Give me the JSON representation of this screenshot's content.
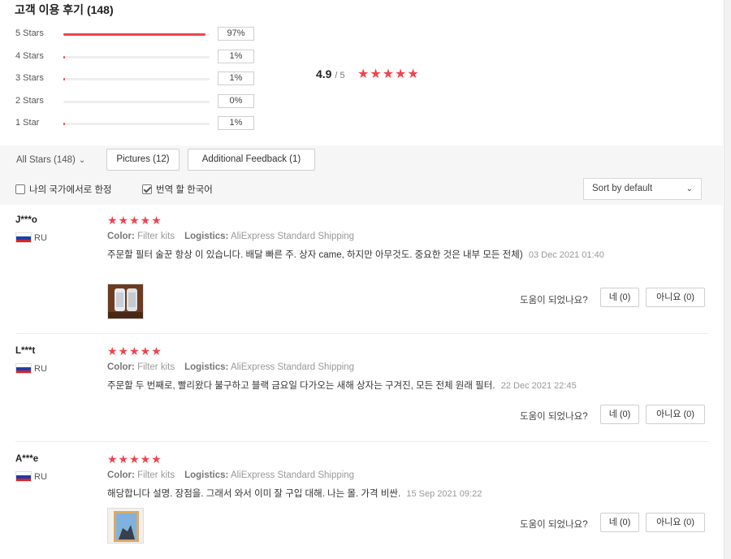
{
  "header": {
    "title": "고객 이용 후기 (148)"
  },
  "rating_breakdown": [
    {
      "label": "5 Stars",
      "percent_text": "97%",
      "fraction": 0.97
    },
    {
      "label": "4 Stars",
      "percent_text": "1%",
      "fraction": 0.01
    },
    {
      "label": "3 Stars",
      "percent_text": "1%",
      "fraction": 0.01
    },
    {
      "label": "2 Stars",
      "percent_text": "0%",
      "fraction": 0.0
    },
    {
      "label": "1 Star",
      "percent_text": "1%",
      "fraction": 0.01
    }
  ],
  "average": {
    "value": "4.9",
    "max": "/ 5",
    "stars": "★★★★★"
  },
  "filters": {
    "all_stars": "All Stars (148)",
    "pictures": "Pictures (12)",
    "additional": "Additional Feedback (1)"
  },
  "options": {
    "my_country": "나의 국가에서로 한정",
    "my_country_checked": false,
    "translate": "번역 할 한국어",
    "translate_checked": true,
    "sort": "Sort by default"
  },
  "reviews": [
    {
      "user": "J***o",
      "country": "RU",
      "stars": "★★★★★",
      "color_label": "Color:",
      "color_value": "Filter kits",
      "logistics_label": "Logistics:",
      "logistics_value": "AliExpress Standard Shipping",
      "text": "주문할 필터 술꾼 항상 이 있습니다. 배달 빠른 주. 상자 came, 하지만 아무것도. 중요한 것은 내부 모든 전체)",
      "date": "03 Dec 2021 01:40",
      "helpful": "도움이 되었나요?",
      "yes": "네 (0)",
      "no": "아니요 (0)"
    },
    {
      "user": "L***t",
      "country": "RU",
      "stars": "★★★★★",
      "color_label": "Color:",
      "color_value": "Filter kits",
      "logistics_label": "Logistics:",
      "logistics_value": "AliExpress Standard Shipping",
      "text": "주문할 두 번째로, 빨리왔다 불구하고 블랙 금요일 다가오는 새해 상자는 구겨진, 모든 전체 원래 필터.",
      "date": "22 Dec 2021 22:45",
      "helpful": "도움이 되었나요?",
      "yes": "네 (0)",
      "no": "아니요 (0)"
    },
    {
      "user": "A***e",
      "country": "RU",
      "stars": "★★★★★",
      "color_label": "Color:",
      "color_value": "Filter kits",
      "logistics_label": "Logistics:",
      "logistics_value": "AliExpress Standard Shipping",
      "text": "해당합니다 설명. 장점을. 그래서 와서 이미 잘 구입 대해. 나는 몰. 가격 비싼.",
      "date": "15 Sep 2021 09:22",
      "helpful": "도움이 되었나요?",
      "yes": "네 (0)",
      "no": "아니요 (0)"
    }
  ]
}
